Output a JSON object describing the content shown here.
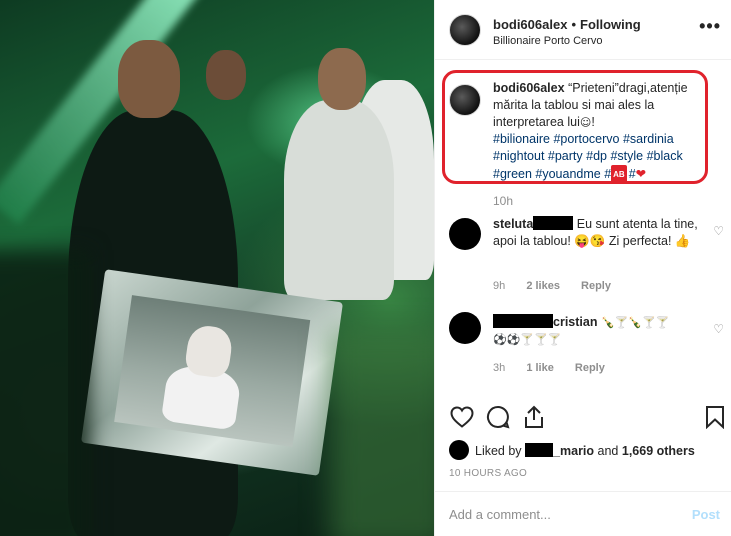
{
  "post": {
    "username": "bodi606alex",
    "follow_status": "Following",
    "location": "Billionaire Porto Cervo",
    "more_menu": "•••"
  },
  "caption": {
    "username": "bodi606alex",
    "text": "“Prieteni”dragi,atenție mărita la tablou si mai ales la interpretarea lui",
    "text_end": "!",
    "hashtags_line1": "#bilionaire #portocervo #sardinia",
    "hashtags_line2": "#nightout #party #dp #style #black",
    "hashtags_line3_a": "#green #youandme #",
    "badge": "AB",
    "hashtags_line3_b": "#",
    "time": "10h"
  },
  "comments": [
    {
      "user_prefix": "steluta",
      "text": "Eu sunt atenta la tine, apoi la tablou! 😝😘 Zi perfecta! 👍",
      "time": "9h",
      "likes": "2 likes",
      "reply": "Reply"
    },
    {
      "user_suffix": "cristian",
      "text_line1": "🍾🍸🍾🍸🍸",
      "text_line2": "⚽⚽🍸🍸🍸",
      "time": "3h",
      "likes": "1 like",
      "reply": "Reply"
    }
  ],
  "likes": {
    "prefix": "Liked by",
    "user_suffix": "_mario",
    "and": "and",
    "count": "1,669 others"
  },
  "time_ago": "10 HOURS AGO",
  "add_comment": {
    "placeholder": "Add a comment...",
    "post_label": "Post"
  },
  "colors": {
    "highlight_box": "#e0222c",
    "hashtag": "#003569",
    "secondary_text": "#8e8e8e",
    "post_button": "#b2dffc"
  },
  "icons": [
    "heart-icon",
    "comment-icon",
    "share-icon",
    "bookmark-icon",
    "more-icon",
    "heart-small-icon"
  ]
}
